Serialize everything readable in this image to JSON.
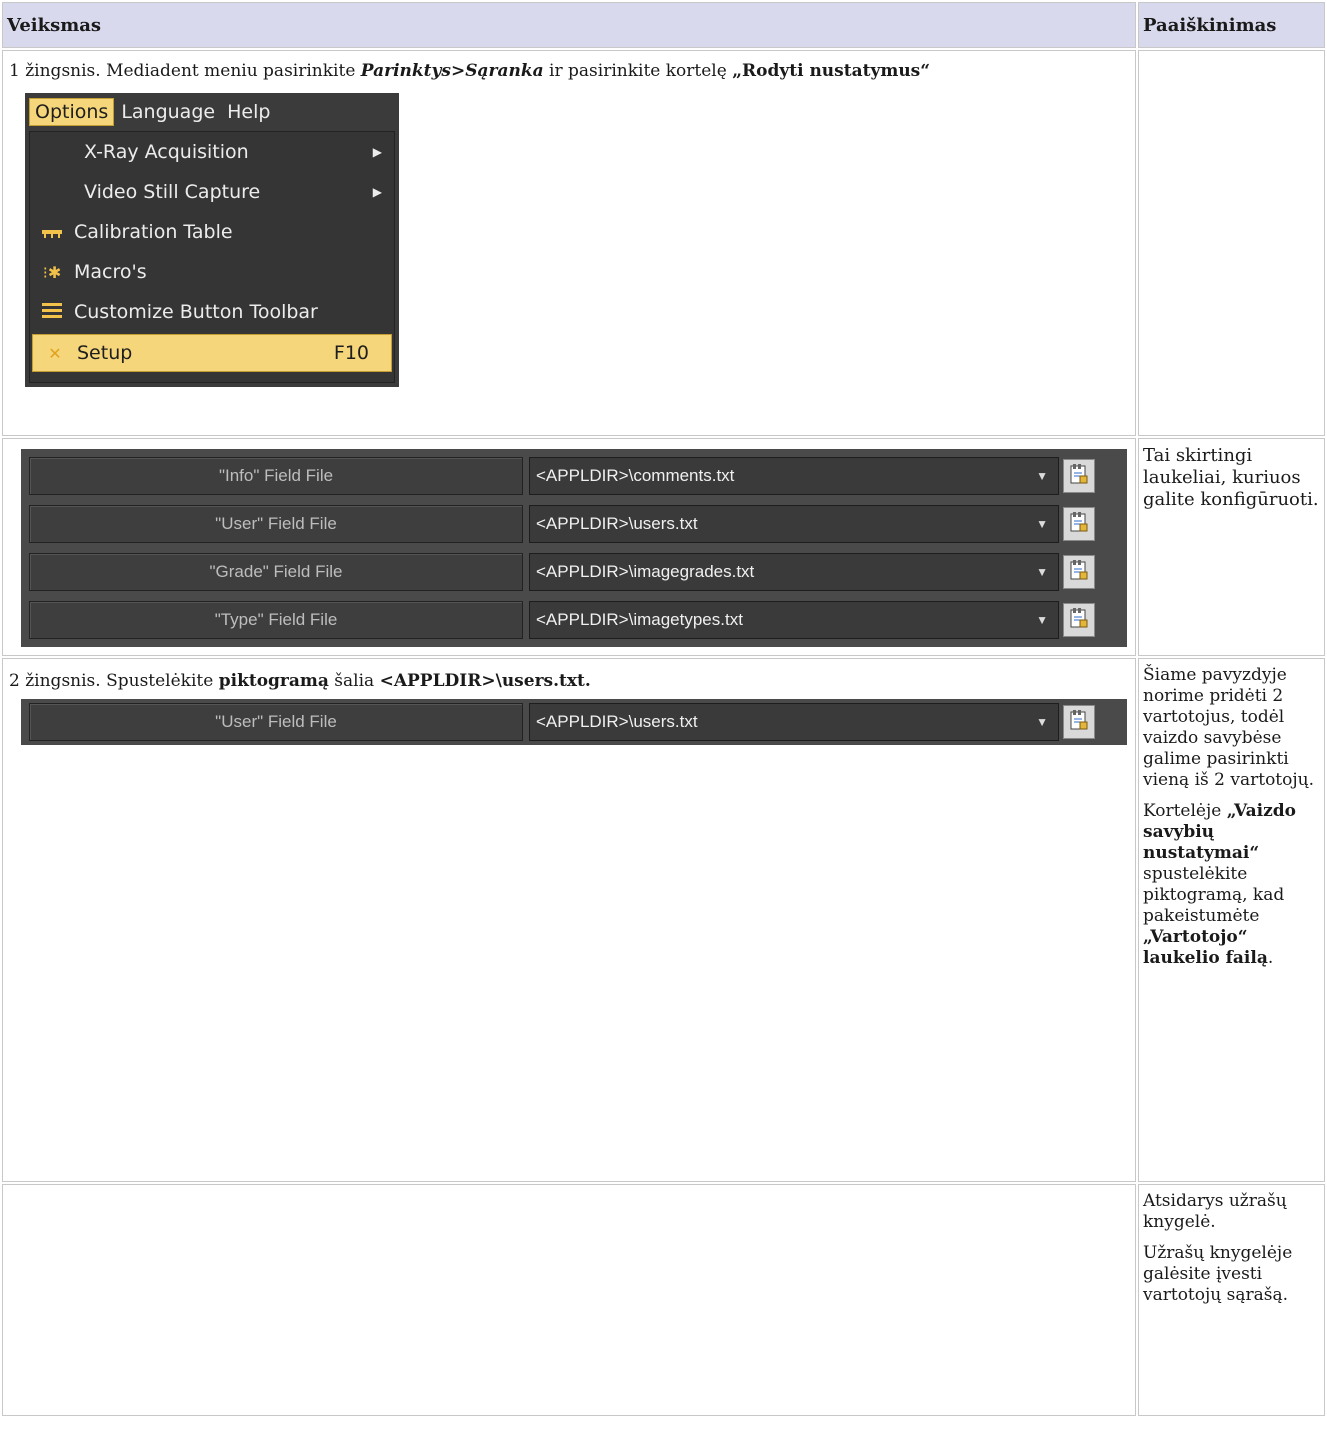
{
  "header": {
    "left": "Veiksmas",
    "right": "Paaiškinimas"
  },
  "row1": {
    "step_prefix": "1 žingsnis. Mediadent meniu pasirinkite ",
    "path": "Parinktys>Sąranka",
    "mid": " ir pasirinkite kortelę ",
    "tab": "„Rodyti nustatymus“",
    "menu": {
      "bar": [
        "Options",
        "Language",
        "Help"
      ],
      "items": [
        {
          "label": "X-Ray Acquisition",
          "icon": ""
        },
        {
          "label": "Video Still Capture",
          "icon": ""
        },
        {
          "label": "Calibration Table",
          "icon": "ruler-icon"
        },
        {
          "label": "Macro's",
          "icon": "macro-icon"
        },
        {
          "label": "Customize Button Toolbar",
          "icon": "hamburger-icon"
        },
        {
          "label": "Setup",
          "icon": "tools-icon",
          "shortcut": "F10"
        }
      ]
    }
  },
  "row2": {
    "fields": [
      {
        "label": "\"Info\" Field File",
        "value": "<APPLDIR>\\comments.txt"
      },
      {
        "label": "\"User\" Field File",
        "value": "<APPLDIR>\\users.txt"
      },
      {
        "label": "\"Grade\" Field File",
        "value": "<APPLDIR>\\imagegrades.txt"
      },
      {
        "label": "\"Type\" Field File",
        "value": "<APPLDIR>\\imagetypes.txt"
      }
    ],
    "explain": "Tai skirtingi laukeliai, kuriuos galite konfigūruoti."
  },
  "row3": {
    "prefix": "2 žingsnis. Spustelėkite ",
    "bold1": "piktogramą",
    "mid": " šalia ",
    "bold2": "<APPLDIR>\\users.txt.",
    "field": {
      "label": "\"User\" Field File",
      "value": "<APPLDIR>\\users.txt"
    },
    "p1": "Šiame pavyzdyje norime pridėti 2 vartotojus, todėl vaizdo savybėse galime pasirinkti vieną iš 2 vartotojų.",
    "p2_a": "Kortelėje ",
    "p2_b": "„Vaizdo savybių nustatymai“",
    "p2_c": " spustelėkite piktogramą, kad pakeistumėte ",
    "p2_d": "„Vartotojo“ laukelio failą",
    "p2_e": "."
  },
  "row4": {
    "p1": "Atsidarys užrašų knygelė.",
    "p2": "Užrašų knygelėje galėsite įvesti vartotojų sąrašą."
  }
}
